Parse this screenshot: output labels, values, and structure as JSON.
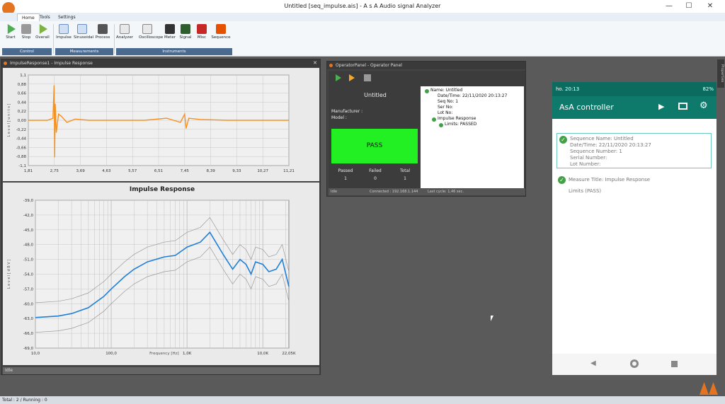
{
  "app": {
    "title": "Untitled [seq_impulse.ais] - A s A  Audio signal Analyzer",
    "minimize": "—",
    "maximize": "☐",
    "close": "✕"
  },
  "ribbon": {
    "tabs": [
      "Home",
      "Tools",
      "Settings"
    ],
    "buttons": [
      "Start",
      "Stop",
      "Overall",
      "Impulse",
      "Sinusoidal",
      "Process",
      "Analyzer",
      "Oscilloscope",
      "Meter",
      "Signal",
      "Misc",
      "Sequence"
    ],
    "groups": [
      "Control",
      "Measurements",
      "Instruments"
    ]
  },
  "impulse_panel": {
    "title": "ImpulseResponse1 - Impulse Response",
    "top_chart": {
      "ylabel": "L e v e l  [ u n i t s ]",
      "yticks": [
        "1,1",
        "0,88",
        "0,66",
        "0,44",
        "0,22",
        "0,00",
        "-0,22",
        "-0,44",
        "-0,66",
        "-0,88",
        "-1,1"
      ],
      "xticks": [
        "1,81",
        "2,75",
        "3,69",
        "4,63",
        "5,57",
        "6,51",
        "7,45",
        "8,39",
        "9,33",
        "10,27",
        "11,21"
      ]
    },
    "bottom_chart": {
      "title": "Impulse Response",
      "ylabel": "L e v e l  [ d B V ]",
      "xlabel": "Frequency [Hz]",
      "yticks": [
        "-39,0",
        "-42,0",
        "-45,0",
        "-48,0",
        "-51,0",
        "-54,0",
        "-57,0",
        "-60,0",
        "-63,0",
        "-66,0",
        "-69,0"
      ],
      "xticks": [
        "10,0",
        "100,0",
        "1,0K",
        "10,0K",
        "22,05K"
      ]
    },
    "status": "Idle"
  },
  "chart_data": [
    {
      "type": "line",
      "title": "",
      "xlabel": "",
      "ylabel": "Level [units]",
      "xlim": [
        1.81,
        11.21
      ],
      "ylim": [
        -1.1,
        1.1
      ],
      "series": [
        {
          "x": [
            1.81,
            2.5,
            2.7,
            2.74,
            2.76,
            2.78,
            2.82,
            2.9,
            3.0,
            3.2,
            3.5,
            4.0,
            5.0,
            6.0,
            6.8,
            7.3,
            7.45,
            7.5,
            7.6,
            8.0,
            9.0,
            10.0,
            11.21
          ],
          "y": [
            0.0,
            0.0,
            0.05,
            0.85,
            -0.9,
            0.4,
            -0.3,
            0.15,
            0.1,
            -0.05,
            0.03,
            0.0,
            0.0,
            0.0,
            0.05,
            -0.05,
            0.15,
            -0.2,
            0.05,
            0.02,
            0.0,
            0.0,
            0.0
          ]
        }
      ]
    },
    {
      "type": "line",
      "title": "Impulse Response",
      "xlabel": "Frequency [Hz]",
      "ylabel": "Level [dBV]",
      "xscale": "log",
      "xlim": [
        10,
        22050
      ],
      "ylim": [
        -69,
        -39
      ],
      "series": [
        {
          "x": [
            10,
            20,
            30,
            50,
            80,
            100,
            150,
            200,
            300,
            500,
            700,
            1000,
            1500,
            2000,
            3000,
            4000,
            5000,
            6000,
            7000,
            8000,
            10000,
            12000,
            15000,
            18000,
            22050
          ],
          "y": [
            -62.8,
            -62.5,
            -62.0,
            -60.8,
            -58.5,
            -57.0,
            -54.5,
            -53.0,
            -51.5,
            -50.5,
            -50.2,
            -48.5,
            -47.5,
            -45.5,
            -50.0,
            -53.0,
            -51.0,
            -52.0,
            -54.0,
            -51.5,
            -52.0,
            -53.5,
            -53.0,
            -51.0,
            -56.5
          ]
        }
      ]
    }
  ],
  "operator": {
    "title": "OperatorPanel - Operator Panel",
    "name": "Untitled",
    "manufacturer": "Manufacturer :",
    "model": "Model :",
    "result": "PASS",
    "result_color": "#22f022",
    "counters": [
      {
        "label": "Passed",
        "value": "1"
      },
      {
        "label": "Failed",
        "value": "0"
      },
      {
        "label": "Total",
        "value": "1"
      }
    ],
    "tree": [
      "Name: Untitled",
      "Date/Time: 22/11/2020 20:13:27",
      "Seq No: 1",
      "Ser No:",
      "Lot No:",
      "Impulse Response",
      "Limits: PASSED"
    ],
    "status": "Idle",
    "connected": "Connected : 192.168.1.144",
    "last_cycle": "Last cycle: 1,46 sec."
  },
  "phone": {
    "time": "ho. 20:13",
    "battery": "82%",
    "app_title": "AsA controller",
    "card": [
      "Sequence Name: Untitled",
      "Date/Time: 22/11/2020 20:13:27",
      "Sequence Number: 1",
      "Serial Number:",
      "Lot Number:"
    ],
    "measure_title": "Measure Title: Impulse Response",
    "limits": "Limits  (PASS)"
  },
  "properties_tab": "Properties",
  "status_bar": "Total : 2  /  Running : 0"
}
